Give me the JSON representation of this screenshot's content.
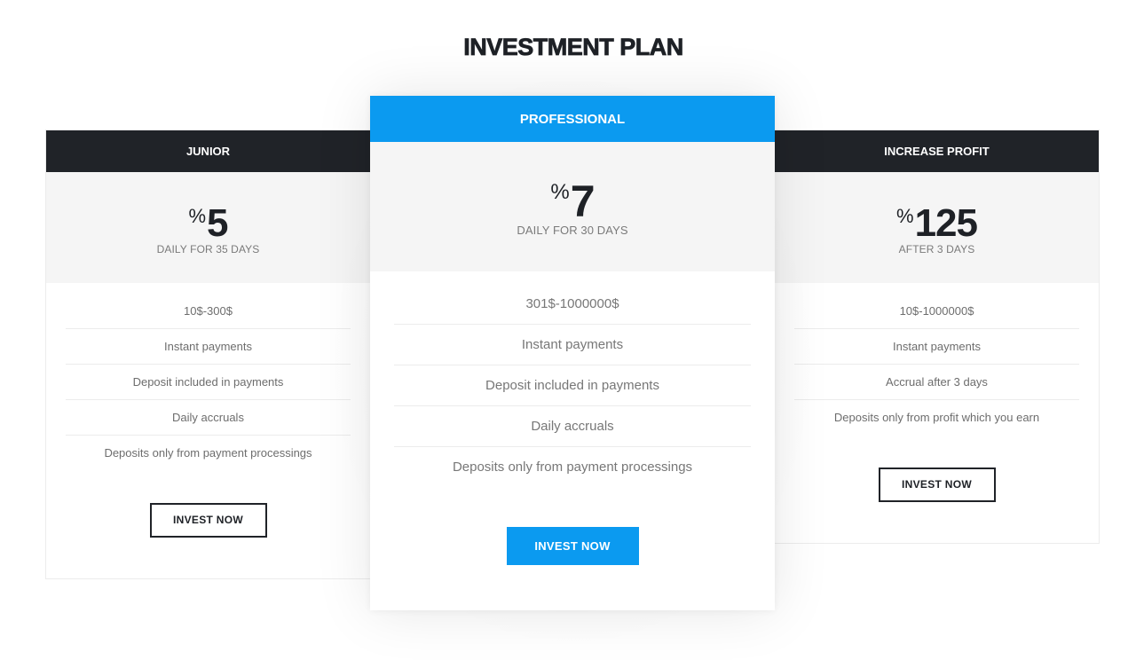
{
  "section": {
    "title": "INVESTMENT PLAN"
  },
  "colors": {
    "accent": "#0b9af0",
    "dark_header": "#202328",
    "price_bg": "#f5f5f5"
  },
  "plans": [
    {
      "name": "JUNIOR",
      "currency_symbol": "%",
      "rate": "5",
      "period": "DAILY FOR 35 DAYS",
      "features": [
        "10$-300$",
        "Instant payments",
        "Deposit included in payments",
        "Daily accruals",
        "Deposits only from payment processings"
      ],
      "button_label": "INVEST NOW",
      "featured": false
    },
    {
      "name": "PROFESSIONAL",
      "currency_symbol": "%",
      "rate": "7",
      "period": "DAILY FOR 30 DAYS",
      "features": [
        "301$-1000000$",
        "Instant payments",
        "Deposit included in payments",
        "Daily accruals",
        "Deposits only from payment processings"
      ],
      "button_label": "INVEST NOW",
      "featured": true
    },
    {
      "name": "INCREASE PROFIT",
      "currency_symbol": "%",
      "rate": "125",
      "period": "AFTER 3 DAYS",
      "features": [
        "10$-1000000$",
        "Instant payments",
        "Accrual after 3 days",
        "Deposits only from profit which you earn"
      ],
      "button_label": "INVEST NOW",
      "featured": false
    }
  ]
}
